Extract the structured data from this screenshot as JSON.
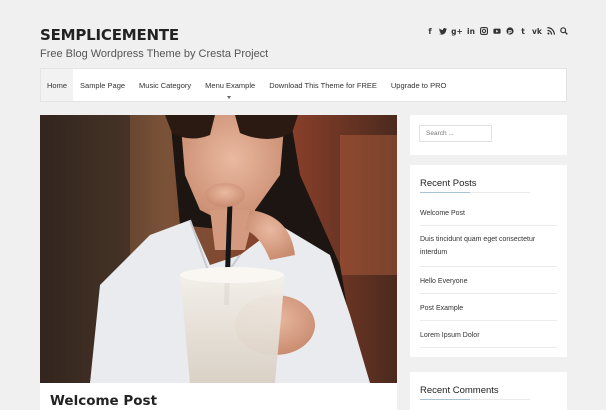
{
  "site": {
    "title": "SEMPLICEMENTE",
    "tagline": "Free Blog Wordpress Theme by Cresta Project"
  },
  "social": [
    "f",
    "t",
    "g+",
    "in",
    "ig",
    "yt",
    "p",
    "t",
    "vk",
    "rss",
    "search"
  ],
  "nav": {
    "items": [
      {
        "label": "Home",
        "active": true
      },
      {
        "label": "Sample Page"
      },
      {
        "label": "Music Category"
      },
      {
        "label": "Menu Example",
        "has_submenu": true
      },
      {
        "label": "Download This Theme for FREE"
      },
      {
        "label": "Upgrade to PRO"
      }
    ]
  },
  "post": {
    "title": "Welcome Post"
  },
  "sidebar": {
    "search_placeholder": "Search ...",
    "recent_posts": {
      "title": "Recent Posts",
      "items": [
        "Welcome Post",
        "Duis tincidunt quam eget consectetur interdum",
        "Hello Everyone",
        "Post Example",
        "Lorem Ipsum Dolor"
      ]
    },
    "recent_comments": {
      "title": "Recent Comments"
    }
  },
  "colors": {
    "background": "#f0f0f0",
    "card": "#ffffff",
    "accent_underline": "#a7c4d4"
  }
}
